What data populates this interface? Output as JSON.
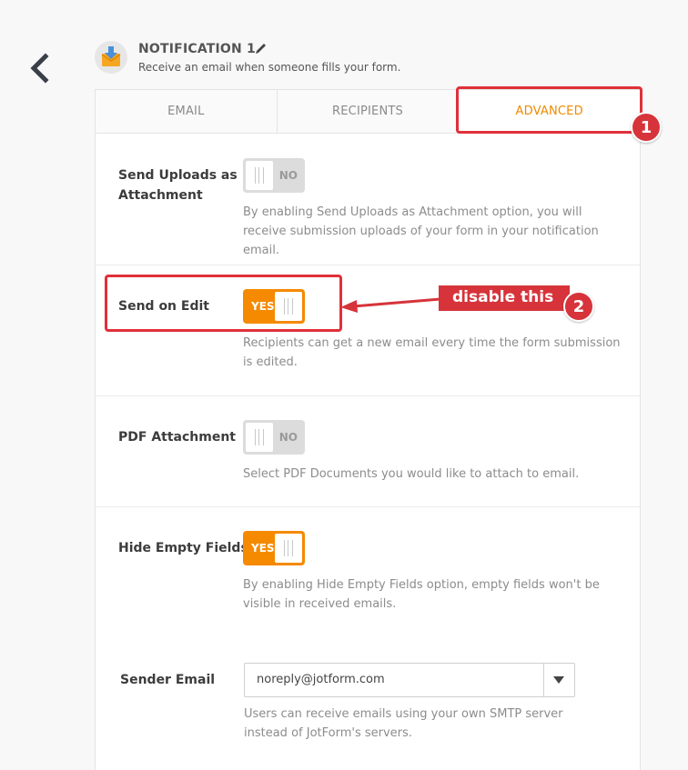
{
  "header": {
    "title": "NOTIFICATION 1",
    "subtitle": "Receive an email when someone fills your form."
  },
  "tabs": [
    {
      "label": "EMAIL"
    },
    {
      "label": "RECIPIENTS"
    },
    {
      "label": "ADVANCED"
    }
  ],
  "settings": {
    "send_uploads": {
      "label": "Send Uploads as Attachment",
      "toggle": "NO",
      "desc": "By enabling Send Uploads as Attachment option, you will receive submission uploads of your form in your notification email."
    },
    "send_on_edit": {
      "label": "Send on Edit",
      "toggle": "YES",
      "desc": "Recipients can get a new email every time the form submission is edited."
    },
    "pdf_attachment": {
      "label": "PDF Attachment",
      "toggle": "NO",
      "desc": "Select PDF Documents you would like to attach to email."
    },
    "hide_empty": {
      "label": "Hide Empty Fields",
      "toggle": "YES",
      "desc": "By enabling Hide Empty Fields option, empty fields won't be visible in received emails."
    },
    "sender_email": {
      "label": "Sender Email",
      "value": "noreply@jotform.com",
      "desc": "Users can receive emails using your own SMTP server instead of JotForm's servers."
    }
  },
  "annotations": {
    "badge1": "1",
    "badge2": "2",
    "callout": "disable this",
    "color": "#d6343a"
  },
  "colors": {
    "accent": "#f58a00",
    "toggle_off": "#dcdcdc"
  }
}
